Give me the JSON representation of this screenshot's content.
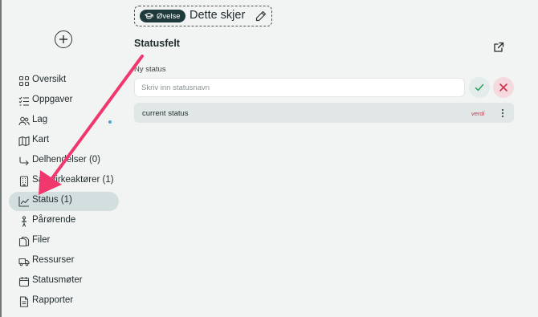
{
  "sidebar": {
    "add_button_icon": "plus-circle-icon",
    "items": [
      {
        "label": "Oversikt",
        "icon": "grid-icon"
      },
      {
        "label": "Oppgaver",
        "icon": "checklist-icon"
      },
      {
        "label": "Lag",
        "icon": "users-icon",
        "has_notification_dot": true
      },
      {
        "label": "Kart",
        "icon": "map-icon"
      },
      {
        "label": "Delhendelser (0)",
        "icon": "branch-arrow-icon"
      },
      {
        "label": "Samvirkeaktører (1)",
        "icon": "building-icon"
      },
      {
        "label": "Status (1)",
        "icon": "chart-line-icon",
        "active": true
      },
      {
        "label": "Pårørende",
        "icon": "person-icon"
      },
      {
        "label": "Filer",
        "icon": "files-icon"
      },
      {
        "label": "Ressurser",
        "icon": "truck-icon"
      },
      {
        "label": "Statusmøter",
        "icon": "calendar-icon"
      },
      {
        "label": "Rapporter",
        "icon": "document-icon"
      }
    ]
  },
  "header": {
    "badge_label": "Øvelse",
    "badge_icon": "graduation-cap-icon",
    "title": "Dette skjer"
  },
  "main": {
    "section_title": "Statusfelt",
    "new_status_label": "Ny status",
    "input_placeholder": "Skriv inn statusnavn",
    "input_value": "",
    "statuses": [
      {
        "name": "current status",
        "tag": "verdi"
      }
    ]
  },
  "colors": {
    "accent_dark": "#1f3a3b",
    "active_nav_bg": "#d3dfdf",
    "confirm_green": "#2f9e57",
    "cancel_red": "#d0304a",
    "annotation_arrow": "#f0386e"
  }
}
